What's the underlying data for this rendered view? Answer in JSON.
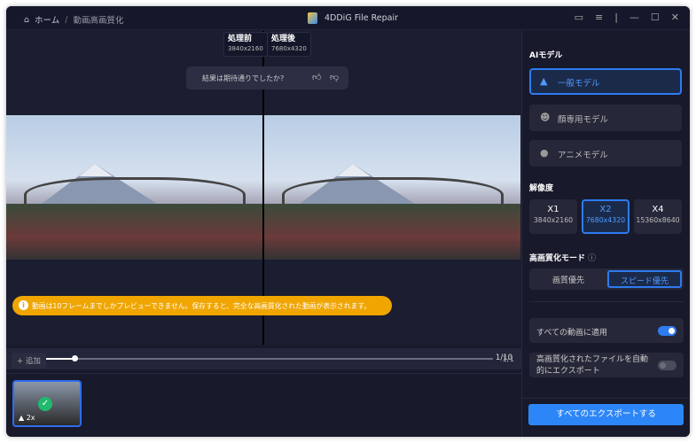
{
  "titlebar": {
    "home": "ホーム",
    "separator": "/",
    "current": "動画高画質化",
    "app_title": "4DDiG File Repair"
  },
  "preview": {
    "before_label": "処理前",
    "before_res": "3840x2160",
    "after_label": "処理後",
    "after_res": "7680x4320",
    "feedback": "結果は期待通りでしたか?",
    "notice": "動画は10フレームまでしかプレビューできません。保存すると、完全な高画質化された動画が表示されます。",
    "frame_counter": "1/10",
    "progress": 0.1
  },
  "filelist": {
    "add_label": "追加",
    "count": "1/1",
    "thumb_tag": "2x"
  },
  "sidebar": {
    "ai_model_heading": "AIモデル",
    "models": [
      {
        "label": "一般モデル",
        "selected": true
      },
      {
        "label": "顔専用モデル"
      },
      {
        "label": "アニメモデル"
      }
    ],
    "resolution_heading": "解像度",
    "resolutions": [
      {
        "label": "X1",
        "value": "3840x2160"
      },
      {
        "label": "X2",
        "value": "7680x4320",
        "selected": true
      },
      {
        "label": "X4",
        "value": "15360x8640"
      }
    ],
    "mode_heading": "高画質化モード",
    "modes": [
      "画質優先",
      "スピード優先"
    ],
    "apply_all": "すべての動画に適用",
    "apply_all_on": true,
    "auto_export": "高画質化されたファイルを自動的にエクスポート",
    "auto_export_on": false,
    "export_button": "すべてのエクスポートする"
  },
  "colors": {
    "accent": "#2d86f7",
    "notice": "#f0a500",
    "check": "#1fba6e"
  }
}
